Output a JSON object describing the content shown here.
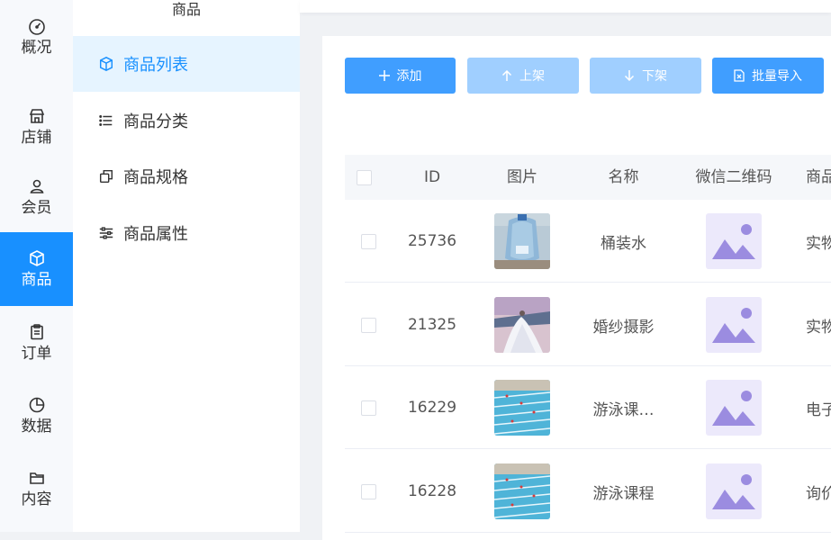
{
  "rail": {
    "items": [
      {
        "label": "概况",
        "icon": "dashboard-icon"
      },
      {
        "label": "店铺",
        "icon": "store-icon"
      },
      {
        "label": "会员",
        "icon": "user-icon"
      },
      {
        "label": "商品",
        "icon": "box-icon",
        "active": true
      },
      {
        "label": "订单",
        "icon": "clipboard-icon"
      },
      {
        "label": "数据",
        "icon": "pie-chart-icon"
      },
      {
        "label": "内容",
        "icon": "folder-icon"
      }
    ]
  },
  "submenu": {
    "title": "商品",
    "items": [
      {
        "label": "商品列表",
        "icon": "box-icon",
        "active": true
      },
      {
        "label": "商品分类",
        "icon": "list-icon"
      },
      {
        "label": "商品规格",
        "icon": "copy-icon"
      },
      {
        "label": "商品属性",
        "icon": "sliders-icon"
      }
    ]
  },
  "toolbar": {
    "add": "添加",
    "on_shelf": "上架",
    "off_shelf": "下架",
    "import": "批量导入"
  },
  "table": {
    "columns": [
      "ID",
      "图片",
      "名称",
      "微信二维码",
      "商品"
    ],
    "rows": [
      {
        "id": "25736",
        "image": "water-bottle-photo",
        "name": "桶装水",
        "type": "实物"
      },
      {
        "id": "21325",
        "image": "wedding-photo",
        "name": "婚纱摄影",
        "type": "实物"
      },
      {
        "id": "16229",
        "image": "swimming-pool-photo",
        "name": "游泳课…",
        "type": "电子"
      },
      {
        "id": "16228",
        "image": "swimming-pool-photo",
        "name": "游泳课程",
        "type": "询价"
      }
    ]
  },
  "colors": {
    "primary": "#409eff",
    "primary_disabled": "#a0cfff",
    "active_rail": "#1890ff",
    "qr_placeholder_bg": "#ece9fb",
    "qr_placeholder_fg": "#9b8ce0"
  }
}
